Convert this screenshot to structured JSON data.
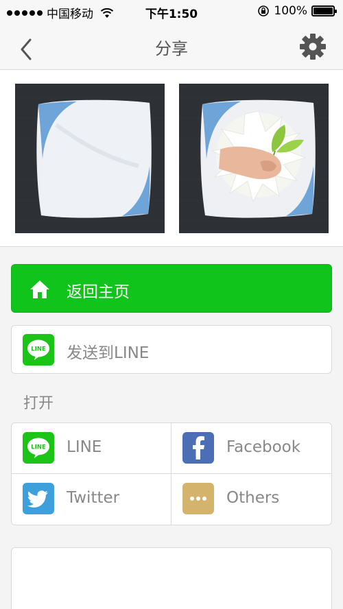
{
  "status_bar": {
    "carrier": "中国移动",
    "time": "下午1:50",
    "battery_percent": "100%",
    "battery_level": 1.0,
    "signal_icon": "signal-dots-icon",
    "wifi_icon": "wifi-icon",
    "lock_icon": "rotation-lock-icon"
  },
  "nav": {
    "title": "分享",
    "back_icon": "chevron-left-icon",
    "settings_icon": "gear-icon"
  },
  "previews": {
    "items": [
      {
        "name": "blank-pillow-image"
      },
      {
        "name": "printed-pillow-image"
      }
    ]
  },
  "actions": {
    "home": {
      "label": "返回主页",
      "icon": "home-icon",
      "color": "#10c41c"
    },
    "send_line": {
      "label": "发送到LINE",
      "icon": "line-logo-icon",
      "color": "#1dc418"
    }
  },
  "open_section": {
    "title": "打开",
    "apps": [
      {
        "label": "LINE",
        "icon": "line-logo-icon",
        "color": "#1dc418"
      },
      {
        "label": "Facebook",
        "icon": "facebook-icon",
        "color": "#4b6eb4"
      },
      {
        "label": "Twitter",
        "icon": "twitter-icon",
        "color": "#3d9fdc"
      },
      {
        "label": "Others",
        "icon": "more-dots-icon",
        "color": "#d4b36c"
      }
    ]
  }
}
